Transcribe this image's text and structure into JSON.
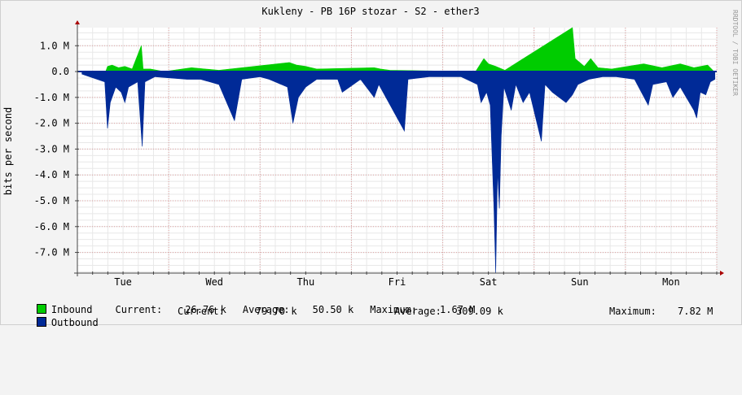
{
  "chart_data": {
    "type": "area",
    "title": "Kukleny - PB 16P stozar - S2 - ether3",
    "ylabel": "bits per second",
    "watermark": "RRDTOOL / TOBI OETIKER",
    "ylim": [
      -7.8,
      1.7
    ],
    "yticks": [
      {
        "v": 1,
        "label": "1.0 M"
      },
      {
        "v": 0,
        "label": "0.0"
      },
      {
        "v": -1,
        "label": "-1.0 M"
      },
      {
        "v": -2,
        "label": "-2.0 M"
      },
      {
        "v": -3,
        "label": "-3.0 M"
      },
      {
        "v": -4,
        "label": "-4.0 M"
      },
      {
        "v": -5,
        "label": "-5.0 M"
      },
      {
        "v": -6,
        "label": "-6.0 M"
      },
      {
        "v": -7,
        "label": "-7.0 M"
      }
    ],
    "xlim": [
      0,
      7
    ],
    "days": [
      {
        "x": 0.5,
        "label": "Tue"
      },
      {
        "x": 1.5,
        "label": "Wed"
      },
      {
        "x": 2.5,
        "label": "Thu"
      },
      {
        "x": 3.5,
        "label": "Fri"
      },
      {
        "x": 4.5,
        "label": "Sat"
      },
      {
        "x": 5.5,
        "label": "Sun"
      },
      {
        "x": 6.5,
        "label": "Mon"
      }
    ],
    "series": [
      {
        "name": "Inbound",
        "color": "#00cc00",
        "points": [
          [
            0.31,
            0.0
          ],
          [
            0.33,
            0.2
          ],
          [
            0.38,
            0.25
          ],
          [
            0.45,
            0.15
          ],
          [
            0.52,
            0.2
          ],
          [
            0.6,
            0.1
          ],
          [
            0.7,
            1.0
          ],
          [
            0.72,
            0.1
          ],
          [
            0.8,
            0.1
          ],
          [
            0.95,
            0.0
          ],
          [
            1.25,
            0.15
          ],
          [
            1.4,
            0.1
          ],
          [
            1.55,
            0.05
          ],
          [
            2.32,
            0.35
          ],
          [
            2.4,
            0.25
          ],
          [
            2.5,
            0.2
          ],
          [
            2.62,
            0.1
          ],
          [
            3.25,
            0.15
          ],
          [
            3.32,
            0.1
          ],
          [
            3.42,
            0.05
          ],
          [
            4.36,
            0.0
          ],
          [
            4.45,
            0.5
          ],
          [
            4.5,
            0.3
          ],
          [
            4.58,
            0.2
          ],
          [
            4.68,
            0.05
          ],
          [
            5.42,
            1.7
          ],
          [
            5.45,
            0.5
          ],
          [
            5.55,
            0.2
          ],
          [
            5.62,
            0.5
          ],
          [
            5.7,
            0.15
          ],
          [
            5.85,
            0.1
          ],
          [
            6.2,
            0.3
          ],
          [
            6.4,
            0.15
          ],
          [
            6.6,
            0.3
          ],
          [
            6.75,
            0.15
          ],
          [
            6.9,
            0.25
          ],
          [
            6.97,
            0.0
          ]
        ]
      },
      {
        "name": "Outbound",
        "color": "#002a97",
        "points": [
          [
            0.05,
            -0.1
          ],
          [
            0.3,
            -0.4
          ],
          [
            0.33,
            -2.2
          ],
          [
            0.36,
            -1.2
          ],
          [
            0.42,
            -0.6
          ],
          [
            0.48,
            -0.8
          ],
          [
            0.52,
            -1.2
          ],
          [
            0.56,
            -0.6
          ],
          [
            0.66,
            -0.4
          ],
          [
            0.71,
            -2.9
          ],
          [
            0.74,
            -0.4
          ],
          [
            0.85,
            -0.2
          ],
          [
            1.2,
            -0.3
          ],
          [
            1.35,
            -0.3
          ],
          [
            1.55,
            -0.5
          ],
          [
            1.72,
            -1.9
          ],
          [
            1.8,
            -0.3
          ],
          [
            2.0,
            -0.2
          ],
          [
            2.1,
            -0.3
          ],
          [
            2.3,
            -0.6
          ],
          [
            2.36,
            -2.0
          ],
          [
            2.42,
            -1.0
          ],
          [
            2.5,
            -0.6
          ],
          [
            2.62,
            -0.3
          ],
          [
            2.85,
            -0.3
          ],
          [
            2.9,
            -0.8
          ],
          [
            3.1,
            -0.3
          ],
          [
            3.25,
            -1.0
          ],
          [
            3.3,
            -0.5
          ],
          [
            3.58,
            -2.3
          ],
          [
            3.62,
            -0.3
          ],
          [
            3.85,
            -0.2
          ],
          [
            4.2,
            -0.2
          ],
          [
            4.38,
            -0.5
          ],
          [
            4.42,
            -1.2
          ],
          [
            4.48,
            -0.8
          ],
          [
            4.52,
            -1.3
          ],
          [
            4.56,
            -5.2
          ],
          [
            4.58,
            -7.8
          ],
          [
            4.6,
            -3.8
          ],
          [
            4.62,
            -5.3
          ],
          [
            4.64,
            -2.5
          ],
          [
            4.67,
            -0.6
          ],
          [
            4.75,
            -1.5
          ],
          [
            4.8,
            -0.5
          ],
          [
            4.88,
            -1.2
          ],
          [
            4.95,
            -0.8
          ],
          [
            5.08,
            -2.7
          ],
          [
            5.12,
            -0.5
          ],
          [
            5.2,
            -0.8
          ],
          [
            5.35,
            -1.2
          ],
          [
            5.42,
            -0.9
          ],
          [
            5.48,
            -0.5
          ],
          [
            5.6,
            -0.3
          ],
          [
            5.75,
            -0.2
          ],
          [
            5.9,
            -0.2
          ],
          [
            6.1,
            -0.3
          ],
          [
            6.25,
            -1.3
          ],
          [
            6.3,
            -0.5
          ],
          [
            6.45,
            -0.4
          ],
          [
            6.52,
            -1.0
          ],
          [
            6.6,
            -0.6
          ],
          [
            6.75,
            -1.5
          ],
          [
            6.78,
            -1.8
          ],
          [
            6.82,
            -0.8
          ],
          [
            6.88,
            -0.9
          ],
          [
            6.93,
            -0.4
          ],
          [
            6.98,
            -0.3
          ]
        ]
      }
    ]
  },
  "legend": {
    "inbound": {
      "label": "Inbound",
      "color": "#00cc00",
      "current_label": "Current:",
      "current": "26.76 k",
      "average_label": "Average:",
      "average": "50.50 k",
      "maximum_label": "Maximum:",
      "maximum": "1.67 M"
    },
    "outbound": {
      "label": "Outbound",
      "color": "#002a97",
      "current_label": "Current:",
      "current": "79.70 k",
      "average_label": "Average:",
      "average": "309.09 k",
      "maximum_label": "Maximum:",
      "maximum": "7.82 M"
    }
  }
}
